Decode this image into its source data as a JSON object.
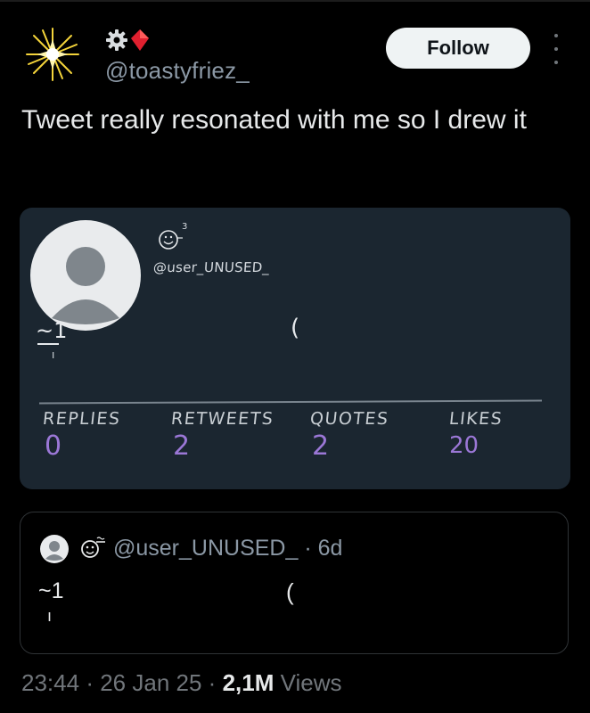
{
  "post": {
    "handle": "@toastyfriez_",
    "avatar_icon": "sparkle-sun-icon",
    "name_icons": [
      "gear-icon",
      "red-diamond-icon"
    ],
    "follow_label": "Follow",
    "more_icon": "more-vertical-icon",
    "text": "Tweet really resonated with me so I drew it",
    "time": "23:44",
    "date": "26 Jan 25",
    "views_count": "2,1M",
    "views_label": "Views",
    "separator": "·"
  },
  "drawing": {
    "background": "#1b2630",
    "handle": "@user_UNUSED_",
    "name_emoji_icon": "smiley-face-icon",
    "name_superscript": "3",
    "tilde_text": "~1",
    "tick_text": "ı",
    "paren_text": "(",
    "stats": [
      {
        "label": "REPLIES",
        "value": "0"
      },
      {
        "label": "RETWEETS",
        "value": "2"
      },
      {
        "label": "QUOTES",
        "value": "2"
      },
      {
        "label": "LIKES",
        "value": "20"
      }
    ]
  },
  "quote": {
    "avatar_icon": "default-avatar-icon",
    "emoji_icon": "smiley-face-icon",
    "handle": "@user_UNUSED_",
    "age": "6d",
    "tilde_text": "~1",
    "tick_text": "ı",
    "paren_text": "("
  }
}
